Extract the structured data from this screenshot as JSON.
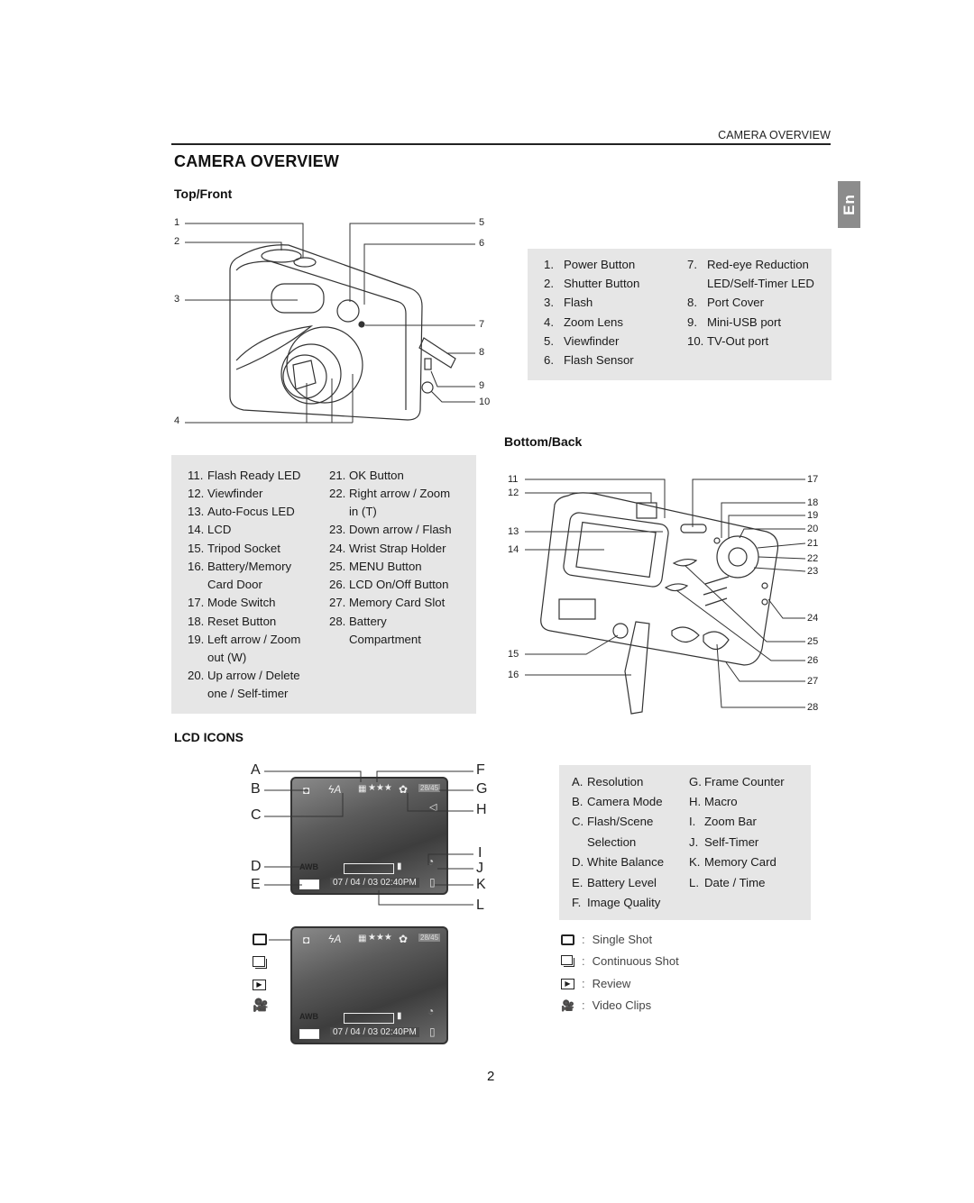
{
  "header": {
    "running_title": "CAMERA OVERVIEW",
    "page_title": "CAMERA OVERVIEW",
    "language_tab": "En"
  },
  "top_front": {
    "heading": "Top/Front",
    "callouts_left": [
      "1",
      "2",
      "3",
      "4"
    ],
    "callouts_right": [
      "5",
      "6",
      "7",
      "8",
      "9",
      "10"
    ],
    "parts": [
      {
        "num": "1.",
        "label": "Power Button"
      },
      {
        "num": "2.",
        "label": "Shutter Button"
      },
      {
        "num": "3.",
        "label": "Flash"
      },
      {
        "num": "4.",
        "label": "Zoom Lens"
      },
      {
        "num": "5.",
        "label": "Viewfinder"
      },
      {
        "num": "6.",
        "label": "Flash Sensor"
      },
      {
        "num": "7.",
        "label": "Red-eye Reduction",
        "label2": "LED/Self-Timer LED"
      },
      {
        "num": "8.",
        "label": "Port Cover"
      },
      {
        "num": "9.",
        "label": "Mini-USB port"
      },
      {
        "num": "10.",
        "label": "TV-Out port"
      }
    ]
  },
  "bottom_back": {
    "heading": "Bottom/Back",
    "callouts_left": [
      "11",
      "12",
      "13",
      "14",
      "15",
      "16"
    ],
    "callouts_right": [
      "17",
      "18",
      "19",
      "20",
      "21",
      "22",
      "23",
      "24",
      "25",
      "26",
      "27",
      "28"
    ],
    "parts_col1": [
      {
        "num": "11.",
        "label": "Flash Ready LED"
      },
      {
        "num": "12.",
        "label": "Viewfinder"
      },
      {
        "num": "13.",
        "label": "Auto-Focus LED"
      },
      {
        "num": "14.",
        "label": "LCD"
      },
      {
        "num": "15.",
        "label": "Tripod Socket"
      },
      {
        "num": "16.",
        "label": "Battery/Memory",
        "label2": "Card Door"
      },
      {
        "num": "17.",
        "label": "Mode Switch"
      },
      {
        "num": "18.",
        "label": "Reset Button"
      },
      {
        "num": "19.",
        "label": "Left arrow / Zoom",
        "label2": "out (W)"
      },
      {
        "num": "20.",
        "label": "Up arrow / Delete",
        "label2": "one / Self-timer"
      }
    ],
    "parts_col2": [
      {
        "num": "21.",
        "label": "OK Button"
      },
      {
        "num": "22.",
        "label": "Right arrow / Zoom",
        "label2": "in (T)"
      },
      {
        "num": "23.",
        "label": "Down arrow / Flash"
      },
      {
        "num": "24.",
        "label": "Wrist Strap Holder"
      },
      {
        "num": "25.",
        "label": "MENU Button"
      },
      {
        "num": "26.",
        "label": "LCD On/Off Button"
      },
      {
        "num": "27.",
        "label": "Memory Card Slot"
      },
      {
        "num": "28.",
        "label": "Battery",
        "label2": "Compartment"
      }
    ]
  },
  "lcd_icons": {
    "heading": "LCD ICONS",
    "letters_left": [
      "A",
      "B",
      "C",
      "D",
      "E"
    ],
    "letters_right": [
      "F",
      "G",
      "H",
      "I",
      "J",
      "K",
      "L"
    ],
    "screen": {
      "frame_counter": "28/45",
      "quality": "★★★",
      "white_balance": "AWB",
      "datetime": "07 / 04 / 03  02:40PM"
    },
    "items_col1": [
      {
        "num": "A.",
        "label": "Resolution"
      },
      {
        "num": "B.",
        "label": "Camera Mode"
      },
      {
        "num": "C.",
        "label": "Flash/Scene",
        "label2": "Selection"
      },
      {
        "num": "D.",
        "label": "White Balance"
      },
      {
        "num": "E.",
        "label": "Battery Level"
      },
      {
        "num": "F.",
        "label": "Image Quality"
      }
    ],
    "items_col2": [
      {
        "num": "G.",
        "label": "Frame Counter"
      },
      {
        "num": "H.",
        "label": "Macro"
      },
      {
        "num": "I.",
        "label": "Zoom Bar"
      },
      {
        "num": "J.",
        "label": "Self-Timer"
      },
      {
        "num": "K.",
        "label": "Memory Card"
      },
      {
        "num": "L.",
        "label": "Date / Time"
      }
    ],
    "modes": [
      {
        "icon": "single-shot-icon",
        "label": "Single Shot"
      },
      {
        "icon": "continuous-shot-icon",
        "label": "Continuous Shot"
      },
      {
        "icon": "review-icon",
        "label": "Review"
      },
      {
        "icon": "video-clips-icon",
        "label": "Video Clips"
      }
    ],
    "separator": ":"
  },
  "footer": {
    "page_number": "2"
  }
}
